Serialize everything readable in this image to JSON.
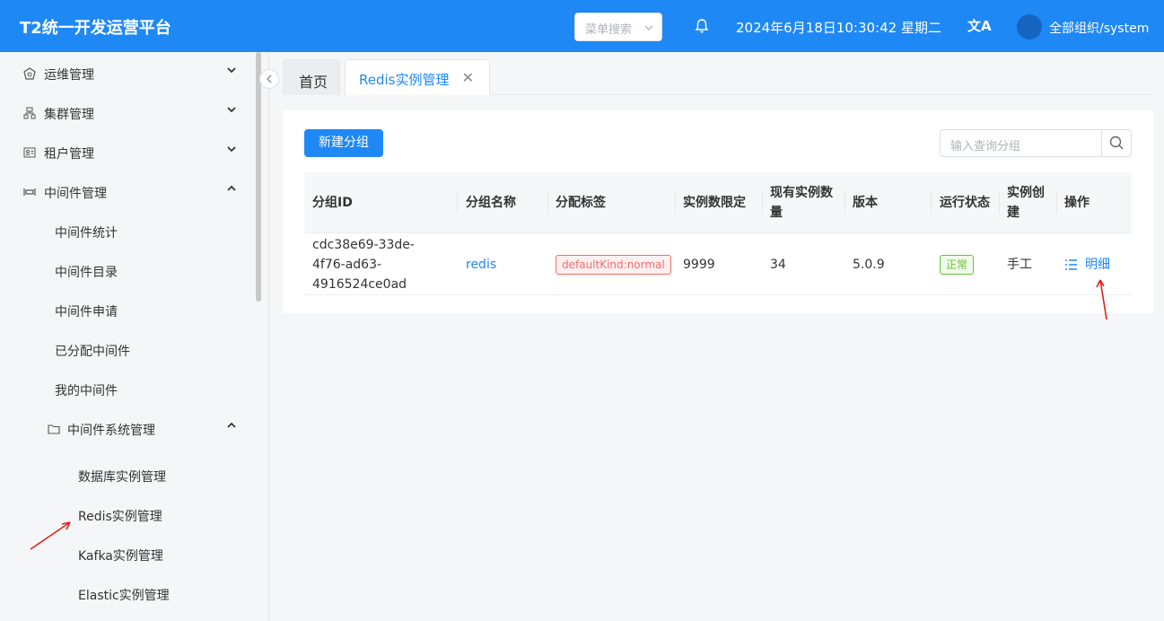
{
  "header": {
    "title": "T2统一开发运营平台",
    "menu_search_placeholder": "菜单搜索",
    "datetime": "2024年6月18日10:30:42 星期二",
    "user": "全部组织/system",
    "translate_icon": "文A"
  },
  "sidebar": {
    "items": [
      {
        "label": "运维管理",
        "icon": "ops-icon",
        "expanded": false
      },
      {
        "label": "集群管理",
        "icon": "cluster-icon",
        "expanded": false
      },
      {
        "label": "租户管理",
        "icon": "tenant-icon",
        "expanded": false
      },
      {
        "label": "中间件管理",
        "icon": "middleware-icon",
        "expanded": true
      }
    ],
    "sub_items": [
      "中间件统计",
      "中间件目录",
      "中间件申请",
      "已分配中间件",
      "我的中间件"
    ],
    "group": {
      "label": "中间件系统管理",
      "icon": "folder-icon",
      "expanded": true
    },
    "group_items": [
      "数据库实例管理",
      "Redis实例管理",
      "Kafka实例管理",
      "Elastic实例管理"
    ]
  },
  "tabs": [
    {
      "label": "首页",
      "active": false
    },
    {
      "label": "Redis实例管理",
      "active": true
    }
  ],
  "toolbar": {
    "new_group_label": "新建分组",
    "search_placeholder": "输入查询分组"
  },
  "table": {
    "columns": [
      "分组ID",
      "分组名称",
      "分配标签",
      "实例数限定",
      "现有实例数量",
      "版本",
      "运行状态",
      "实例创建",
      "操作"
    ],
    "rows": [
      {
        "group_id": "cdc38e69-33de-4f76-ad63-4916524ce0ad",
        "group_name": "redis",
        "tag": "defaultKind:normal",
        "limit": "9999",
        "count": "34",
        "version": "5.0.9",
        "status": "正常",
        "creation": "手工",
        "action": "明细"
      }
    ]
  },
  "colors": {
    "primary": "#1e88f5",
    "annotation": "#e02020"
  }
}
